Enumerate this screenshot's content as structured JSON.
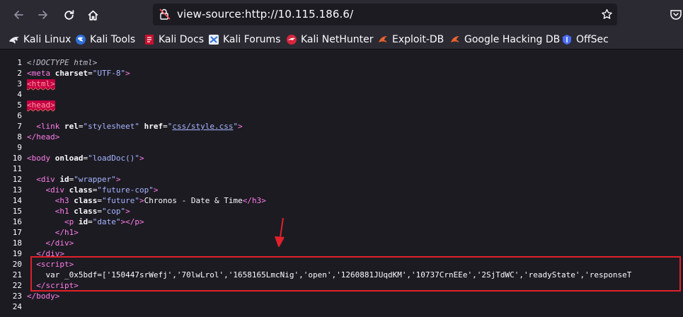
{
  "browser": {
    "url": "view-source:http://10.115.186.6/",
    "nav": {
      "back_icon": "arrow-left-icon",
      "forward_icon": "arrow-right-icon",
      "reload_icon": "reload-icon",
      "home_icon": "home-icon"
    }
  },
  "bookmarks": [
    {
      "label": "Kali Linux",
      "icon": "kali-dragon-icon"
    },
    {
      "label": "Kali Tools",
      "icon": "kali-tools-icon"
    },
    {
      "label": "Kali Docs",
      "icon": "kali-docs-icon"
    },
    {
      "label": "Kali Forums",
      "icon": "kali-forums-icon"
    },
    {
      "label": "Kali NetHunter",
      "icon": "kali-nethunter-icon"
    },
    {
      "label": "Exploit-DB",
      "icon": "exploit-db-icon"
    },
    {
      "label": "Google Hacking DB",
      "icon": "ghdb-icon"
    },
    {
      "label": "OffSec",
      "icon": "offsec-icon"
    }
  ],
  "source": {
    "line_numbers": [
      "1",
      "2",
      "3",
      "4",
      "5",
      "6",
      "7",
      "8",
      "9",
      "10",
      "11",
      "12",
      "13",
      "14",
      "15",
      "16",
      "17",
      "18",
      "19",
      "20",
      "21",
      "22",
      "23",
      "24"
    ],
    "doctype": "<!DOCTYPE html>",
    "charset_value": "UTF-8",
    "stylesheet_rel": "stylesheet",
    "stylesheet_href": "css/style.css",
    "onload_value": "loadDoc()",
    "wrapper_id": "wrapper",
    "div_class": "future-cop",
    "h3_class": "future",
    "h3_text": "Chronos - Date & Time",
    "h1_class": "cop",
    "p_id": "date",
    "script_text": "var _0x5bdf=['150447srWefj','70lwLrol','1658165LmcNig','open','1260881JUqdKM','10737CrnEEe','2SjTdWC','readyState','responseT"
  },
  "colors": {
    "annotation_red": "#e0202a",
    "tag": "#ff7de9",
    "value": "#a7b5ff"
  }
}
